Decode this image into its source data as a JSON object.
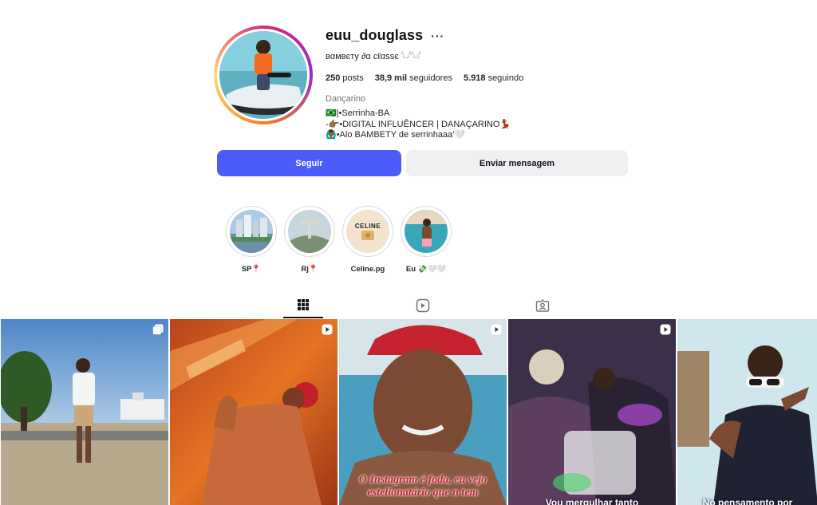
{
  "profile": {
    "username": "euu_douglass",
    "more_label": "···",
    "full_name": "вαмвєту ∂α cℓαѕѕє 𓆩𓆪𓆩𓆪",
    "stats": {
      "posts_count": "250",
      "posts_label": "posts",
      "followers_count": "38,9 mil",
      "followers_label": "seguidores",
      "following_count": "5.918",
      "following_label": "seguindo"
    },
    "category": "Dançarino",
    "bio_lines": [
      "🇧🇷|•Serrinha-BA",
      "-👉🏾•DIGITAL INFLUÊNCER | DANAÇARINO💃🏾",
      "🙆🏾‍♂️•Alo BAMBETY de serrinhaaa'🤍"
    ]
  },
  "actions": {
    "follow_label": "Seguir",
    "message_label": "Enviar mensagem"
  },
  "highlights": [
    {
      "label": "SP📍"
    },
    {
      "label": "Rj📍"
    },
    {
      "label": "Celine.pg",
      "thumb_text": "CELINE"
    },
    {
      "label": "Eu 💸🤍🤍"
    }
  ],
  "tabs": [
    {
      "icon": "grid-icon",
      "active": true
    },
    {
      "icon": "reels-icon",
      "active": false
    },
    {
      "icon": "tagged-icon",
      "active": false
    }
  ],
  "posts": [
    {
      "type": "carousel",
      "icon": "carousel-icon"
    },
    {
      "type": "reel",
      "icon": "reel-icon"
    },
    {
      "type": "reel",
      "icon": "reel-icon",
      "caption": "O Instagram é foda, eu vejo estelionatário que n tem"
    },
    {
      "type": "reel",
      "icon": "reel-icon",
      "caption": "Vou mergulhar tanto"
    },
    {
      "type": "reel",
      "caption": "No pensamento por"
    }
  ],
  "colors": {
    "follow_button": "#4a5df9",
    "message_button": "#efeff2",
    "caption_red": "#c81d2c"
  }
}
